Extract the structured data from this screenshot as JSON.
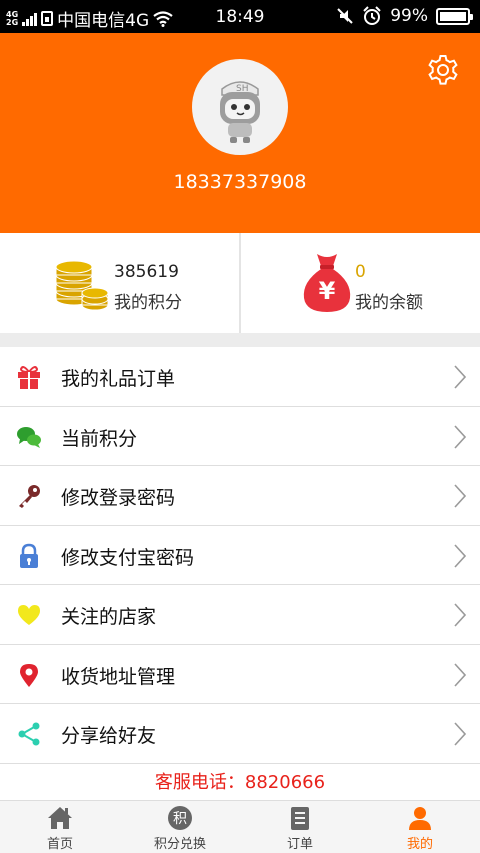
{
  "status_bar": {
    "network_top": "4G",
    "network_bottom": "2G",
    "carrier": "中国电信4G",
    "time": "18:49",
    "battery": "99%",
    "battery_level": 0.99
  },
  "profile": {
    "phone": "18337337908",
    "avatar_badge": "SH"
  },
  "stats": {
    "points": {
      "value": "385619",
      "label": "我的积分"
    },
    "balance": {
      "value": "0",
      "label": "我的余额",
      "symbol": "¥"
    }
  },
  "menu": [
    {
      "label": "我的礼品订单",
      "icon": "gift-icon"
    },
    {
      "label": "当前积分",
      "icon": "chat-bubbles-icon"
    },
    {
      "label": "修改登录密码",
      "icon": "key-icon"
    },
    {
      "label": "修改支付宝密码",
      "icon": "lock-icon"
    },
    {
      "label": "关注的店家",
      "icon": "heart-icon"
    },
    {
      "label": "收货地址管理",
      "icon": "location-pin-icon"
    },
    {
      "label": "分享给好友",
      "icon": "share-icon"
    }
  ],
  "hotline": "客服电话：8820666",
  "tabbar": [
    {
      "label": "首页",
      "icon": "home-icon"
    },
    {
      "label": "积分兑换",
      "icon": "points-icon",
      "glyph": "积"
    },
    {
      "label": "订单",
      "icon": "order-icon"
    },
    {
      "label": "我的",
      "icon": "user-icon",
      "active": true
    }
  ],
  "colors": {
    "brand": "#ff6a00",
    "hotline": "#e8221b",
    "balance": "#d9a400"
  }
}
